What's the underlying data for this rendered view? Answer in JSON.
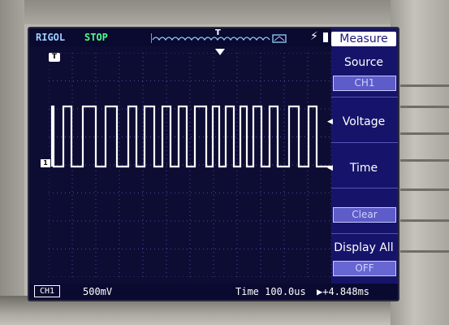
{
  "header": {
    "brand": "RIGOL",
    "run_state": "STOP",
    "trigger_marker": "T"
  },
  "markers": {
    "trigger_position": "T",
    "channel": "1"
  },
  "menu": {
    "title": "Measure",
    "items": [
      {
        "label": "Source",
        "value": "CH1"
      },
      {
        "label": "Voltage",
        "value": ""
      },
      {
        "label": "Time",
        "value": ""
      },
      {
        "label": "",
        "value": "Clear"
      },
      {
        "label": "Display All",
        "value": "OFF"
      }
    ]
  },
  "status": {
    "channel": "CH1",
    "volts_per_div": "500mV",
    "time_label": "Time",
    "time_per_div": "100.0us",
    "trigger_offset": "+4.848ms"
  },
  "colors": {
    "screen": "#0d0c33",
    "menu": "#16146a",
    "trace": "#ffffff",
    "brand": "#9ad0ff",
    "run_state": "#4cff88"
  }
}
